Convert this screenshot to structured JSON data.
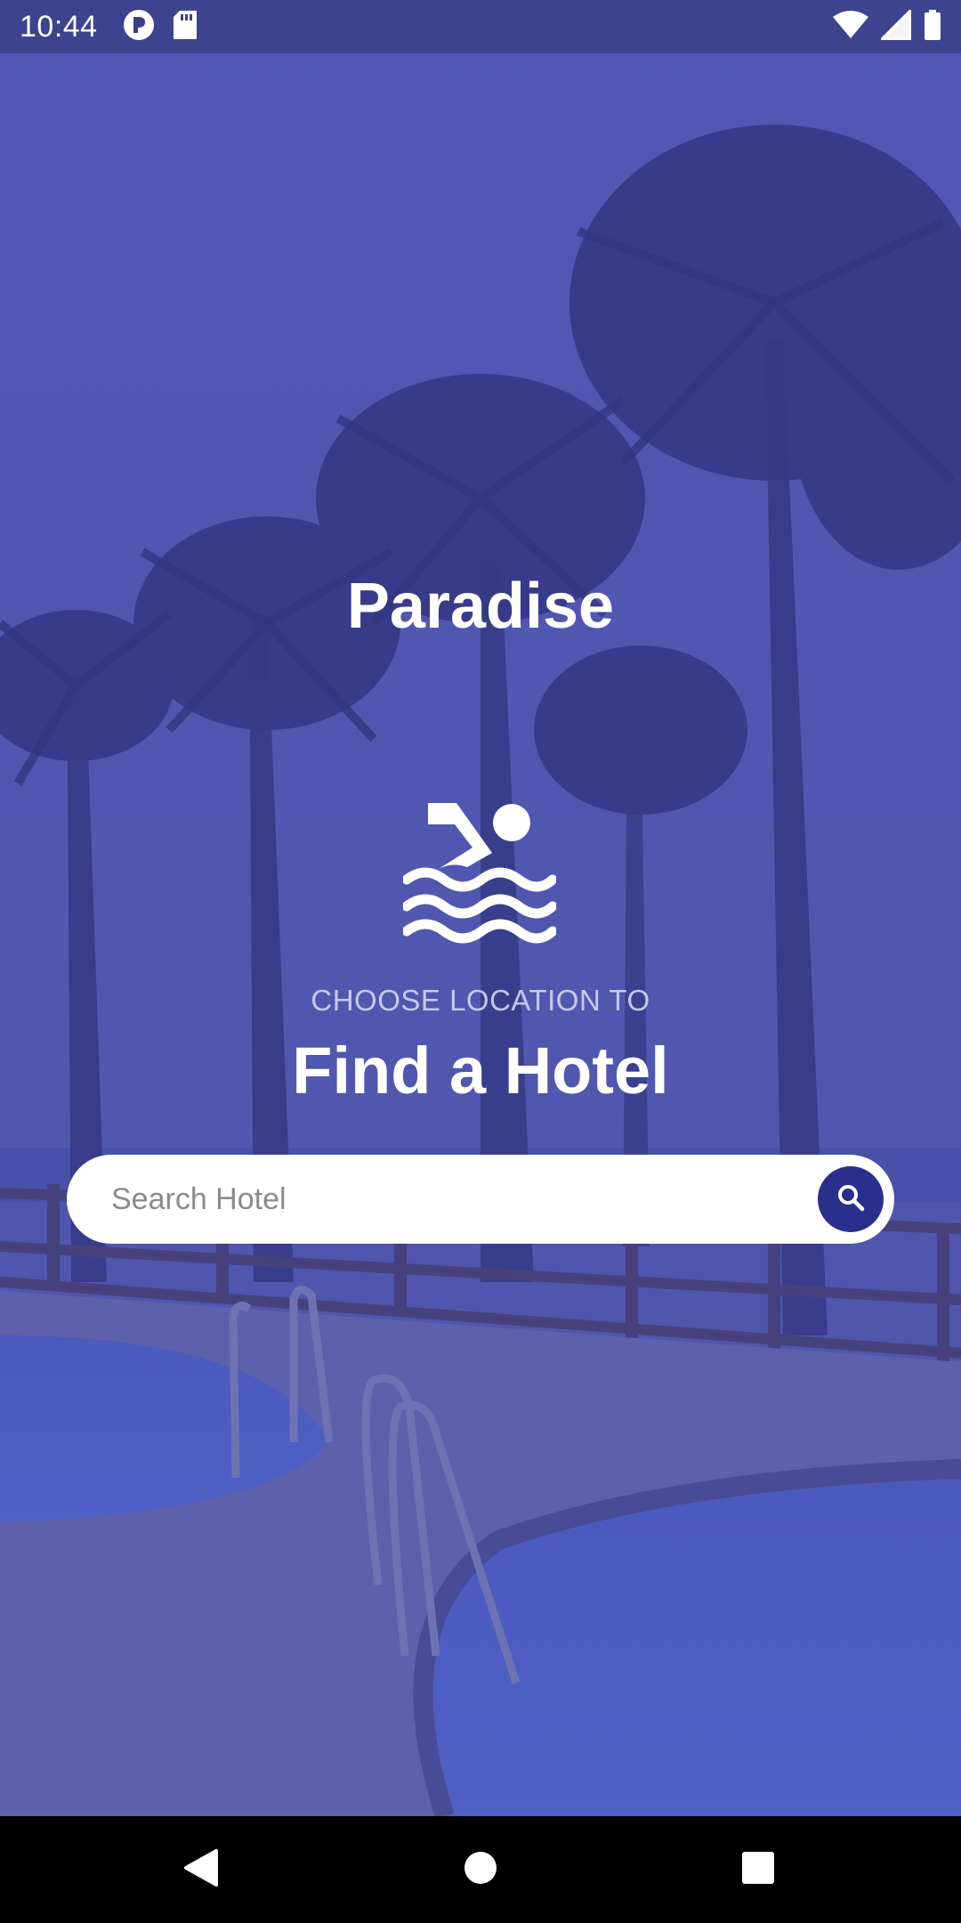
{
  "status_bar": {
    "time": "10:44",
    "left_icons": [
      "notification-app-icon",
      "sd-card-icon"
    ],
    "right_icons": [
      "wifi-icon",
      "signal-icon",
      "battery-icon"
    ]
  },
  "app": {
    "title": "Paradise",
    "icon": "swimming-icon",
    "subtitle": "CHOOSE LOCATION TO",
    "heading": "Find a Hotel"
  },
  "search": {
    "placeholder": "Search Hotel",
    "value": "",
    "button_icon": "search-icon"
  },
  "nav_bar": {
    "buttons": [
      "back-icon",
      "home-icon",
      "recents-icon"
    ]
  },
  "colors": {
    "tint": "#464caf",
    "search_button": "#2a2f8c",
    "text": "#ffffff"
  }
}
